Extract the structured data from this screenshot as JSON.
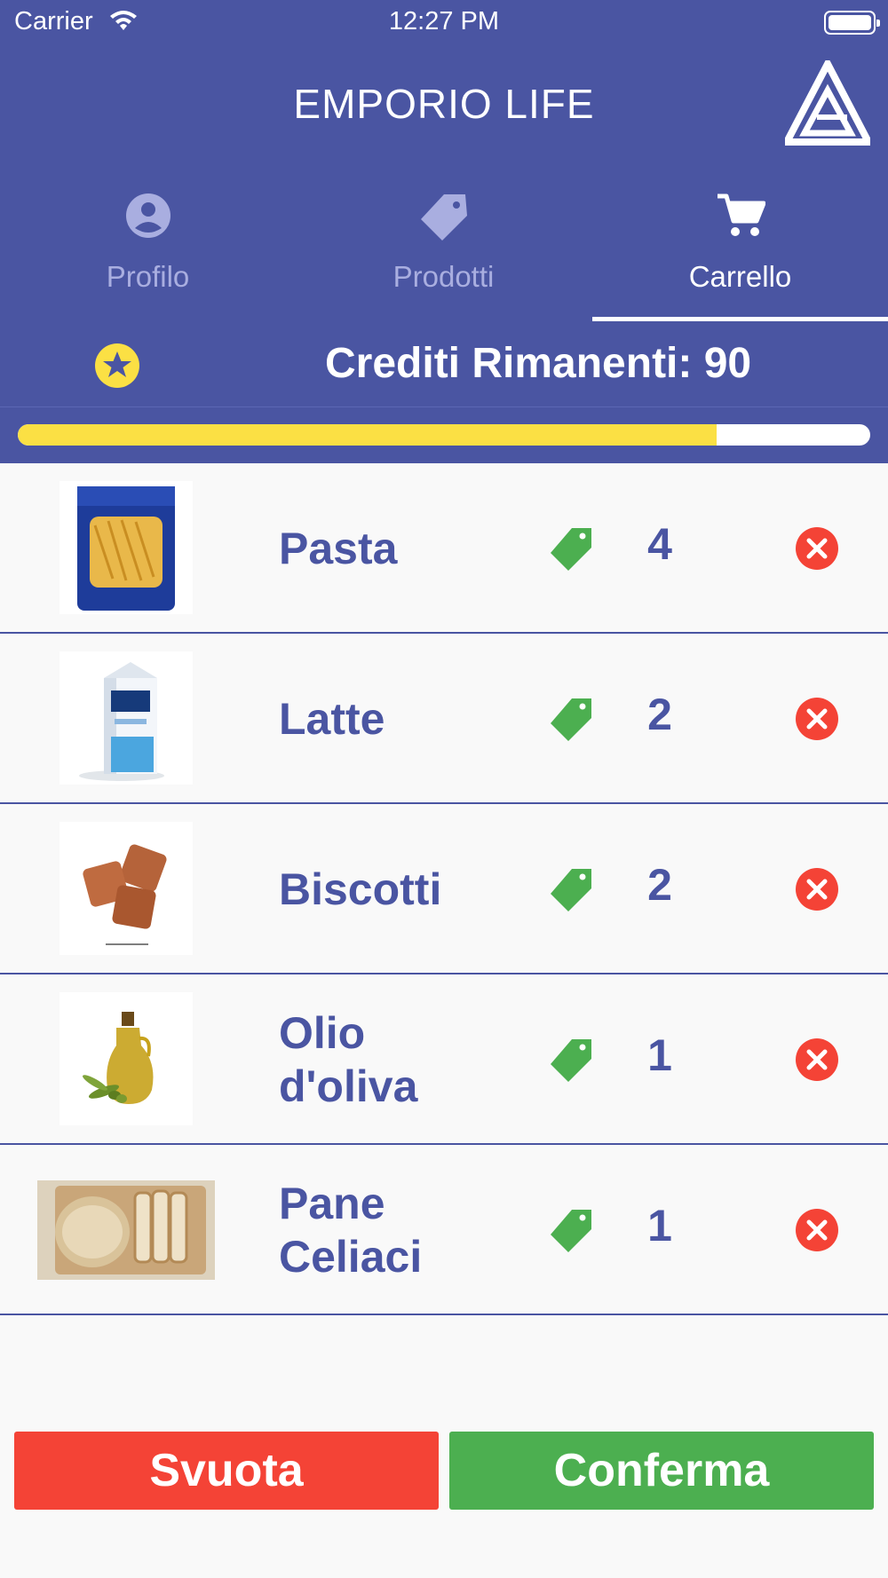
{
  "status_bar": {
    "carrier": "Carrier",
    "time": "12:27 PM"
  },
  "app": {
    "title": "EMPORIO LIFE"
  },
  "tabs": [
    {
      "label": "Profilo",
      "icon": "account-circle-icon"
    },
    {
      "label": "Prodotti",
      "icon": "tag-icon"
    },
    {
      "label": "Carrello",
      "icon": "cart-icon"
    }
  ],
  "active_tab": "Carrello",
  "credits": {
    "label": "Crediti Rimanenti: 90",
    "progress_fraction": 0.82
  },
  "cart": {
    "items": [
      {
        "name": "Pasta",
        "qty": "4"
      },
      {
        "name": "Latte",
        "qty": "2"
      },
      {
        "name": "Biscotti",
        "qty": "2"
      },
      {
        "name": "Olio d'oliva",
        "qty": "1"
      },
      {
        "name": "Pane Celiaci",
        "qty": "1"
      }
    ]
  },
  "buttons": {
    "clear_label": "Svuota",
    "confirm_label": "Conferma"
  },
  "colors": {
    "header": "#4a55a2",
    "accent_yellow": "#fbe044",
    "danger": "#f44336",
    "success": "#4caf50"
  }
}
